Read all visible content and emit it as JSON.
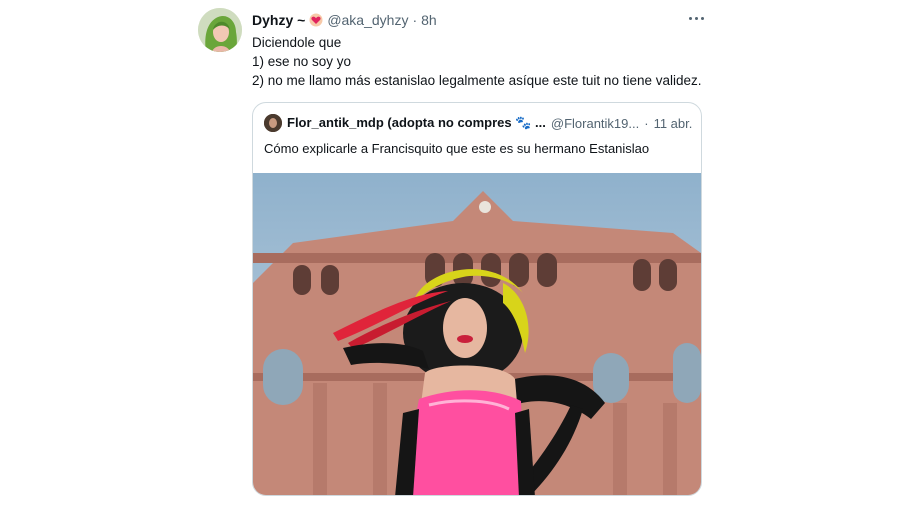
{
  "tweet": {
    "display_name": "Dyhzy ~",
    "handle": "@aka_dyhzy",
    "separator": "·",
    "time": "8h",
    "lines": [
      "Diciendole que",
      "1) ese no soy yo",
      "2) no me llamo más estanislao legalmente asíque este tuit no tiene validez."
    ]
  },
  "quoted": {
    "display_name": "Flor_antik_mdp (adopta no compres 🐾 ...",
    "handle": "@Florantik19...",
    "separator": "·",
    "time": "11 abr.",
    "text": "Cómo explicarle a Francisquito que este es su hermano Estanislao"
  },
  "icons": {
    "more": "more-horizontal-icon",
    "badge": "heart-emoji-icon"
  },
  "colors": {
    "text_primary": "#0f1419",
    "text_secondary": "#536471",
    "border": "#cfd9de",
    "building": "#c88a7a",
    "sky": "#9fb8cf",
    "outfit": "#ff4fa0"
  }
}
